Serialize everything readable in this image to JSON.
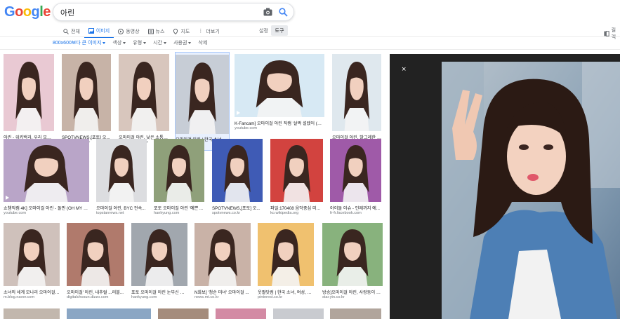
{
  "logo": "Google",
  "search": {
    "value": "아린"
  },
  "tabs": [
    {
      "label": "전체",
      "icon": "search-icon",
      "active": false
    },
    {
      "label": "이미지",
      "icon": "image-icon",
      "active": true
    },
    {
      "label": "동영상",
      "icon": "video-icon",
      "active": false
    },
    {
      "label": "뉴스",
      "icon": "news-icon",
      "active": false
    },
    {
      "label": "지도",
      "icon": "map-pin-icon",
      "active": false
    },
    {
      "label": "더보기",
      "icon": "more-icon",
      "active": false
    }
  ],
  "settings_label": "설정",
  "tools_label": "도구",
  "collection_label": "컬렉",
  "filters": [
    {
      "label": "800x600보다 큰 이미지",
      "selected": true
    },
    {
      "label": "색상",
      "selected": false
    },
    {
      "label": "유형",
      "selected": false
    },
    {
      "label": "시간",
      "selected": false
    },
    {
      "label": "사용권",
      "selected": false
    },
    {
      "label": "삭제",
      "selected": false
    }
  ],
  "results": [
    {
      "caption": "아린 - 위키백과, 우리 모두...",
      "source": "ko.wikipedia.org"
    },
    {
      "caption": "SPOTVNEWS,[포토] 오...",
      "source": "spotvnews.co.kr"
    },
    {
      "caption": "오마이걸 아린, 낮은 소통지...",
      "source": "futurekorea.co.kr"
    },
    {
      "caption": "오마이걸 아린 | 한국 소녀, ...",
      "source": "pinterest.co.kr"
    },
    {
      "caption": "K-Fancam] 오마이걸 아린 직캠 '살짝 설렜어 (No...",
      "source": "youtube.com"
    },
    {
      "caption": "오마이걸 아린, 발그레한 두...",
      "source": "edaily.co.kr"
    },
    {
      "caption": "쇼챔직캠 4K] 오마이걸 아린 - 돌핀 (OH MY GI...",
      "source": "youtube.com"
    },
    {
      "caption": "오마이걸 아린, BYC 전속...",
      "source": "topstarnews.net"
    },
    {
      "caption": "포토 오마이걸 아린 '예쁜 ...",
      "source": "hankyung.com"
    },
    {
      "caption": "SPOTVNEWS,[포토] 오...",
      "source": "spotvnews.co.kr"
    },
    {
      "caption": "파일:170408 음악중심 미니...",
      "source": "ko.wikipedia.org"
    },
    {
      "caption": "아이돌 이슈 - 인제까지 예...",
      "source": "fr-fr.facebook.com"
    },
    {
      "caption": "소녀의 세계 모나리 오마이걸 ...",
      "source": "m.blog.naver.com"
    },
    {
      "caption": "오마이걸' 아린, 내추럴 ...러블...",
      "source": "digitalchosun.dizzo.com"
    },
    {
      "caption": "포토 오마이걸 아린 눈부신 미...",
      "source": "hankyung.com"
    },
    {
      "caption": "N화보] '청순 미녀' 오마이걸 ...",
      "source": "news.mt.co.kr"
    },
    {
      "caption": "웃짤닷컴 | 한국 소녀, 여성, 아...",
      "source": "pinterest.co.kr"
    },
    {
      "caption": "방송]오마이걸 아린, 사랑둥이 막...",
      "source": "star.ytn.co.kr"
    }
  ],
  "close_label": "×"
}
